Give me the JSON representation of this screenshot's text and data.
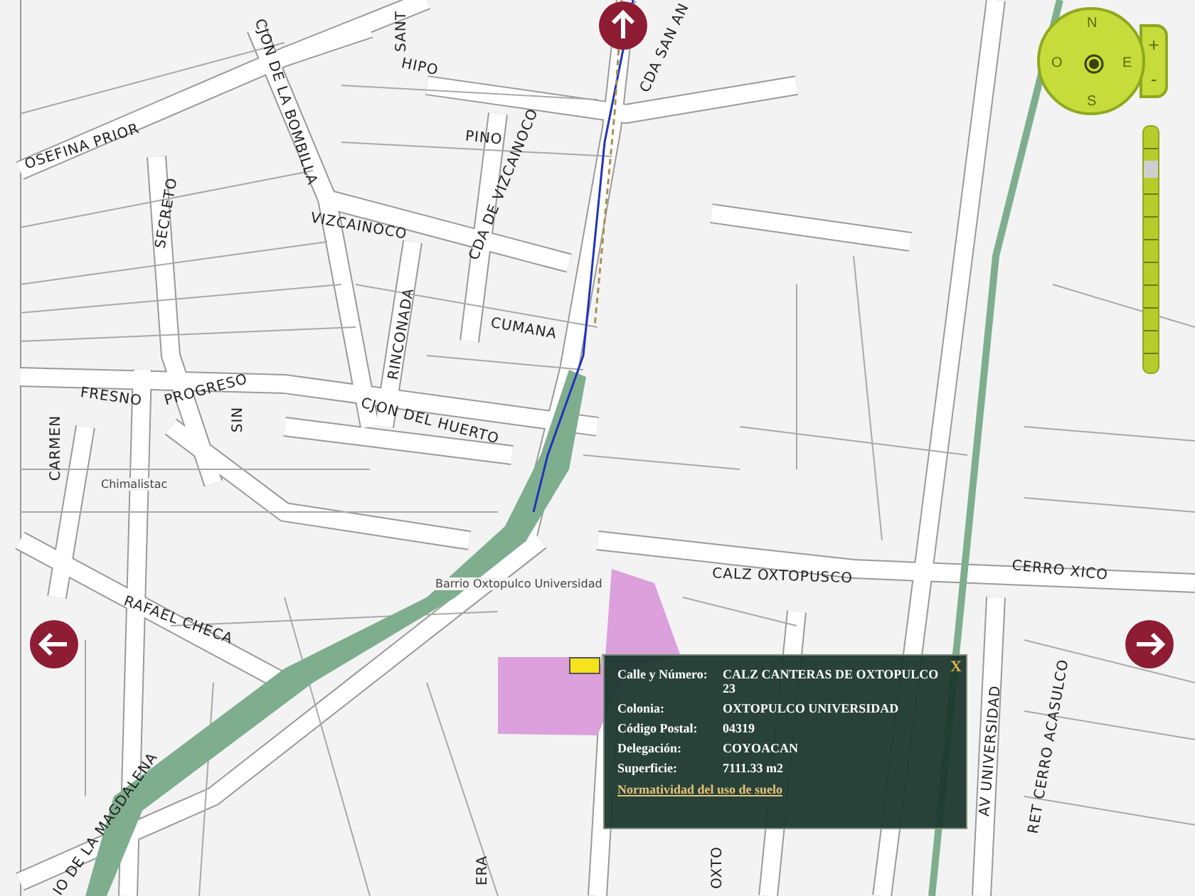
{
  "map": {
    "street_labels": [
      "SANT",
      "HIPO",
      "PINO",
      "CJON DE LA BOMBILLA",
      "OSEFINA PRIOR",
      "SECRETO",
      "VIZCAINOCO",
      "CDA DE VIZCAINOCO",
      "CDA SAN AN",
      "CUMANA",
      "RINCONADA",
      "FRESNO",
      "PROGRESO",
      "SIN",
      "CJON DEL HUERTO",
      "CARMEN",
      "CALZ OXTOPUSCO",
      "CERRO XICO",
      "RAFAEL CHECA",
      "IO DE LA MAGDALENA",
      "AV UNIVERSIDAD",
      "RET CERRO ACASULCO",
      "ERA",
      "OXTO"
    ],
    "place_labels": [
      "Chimalistac",
      "Barrio Oxtopulco Universidad"
    ]
  },
  "compass": {
    "north": "N",
    "south": "S",
    "east": "E",
    "west": "O",
    "zoom_in": "+",
    "zoom_out": "-"
  },
  "zoom_slider": {
    "level": 0.85
  },
  "popup": {
    "close": "X",
    "fields": [
      {
        "label": "Calle y Número:",
        "value": "CALZ CANTERAS DE OXTOPULCO 23"
      },
      {
        "label": "Colonia:",
        "value": "OXTOPULCO UNIVERSIDAD"
      },
      {
        "label": "Código Postal:",
        "value": "04319"
      },
      {
        "label": "Delegación:",
        "value": "COYOACAN"
      },
      {
        "label": "Superficie:",
        "value": "7111.33 m2"
      }
    ],
    "link": "Normatividad del uso de suelo"
  }
}
